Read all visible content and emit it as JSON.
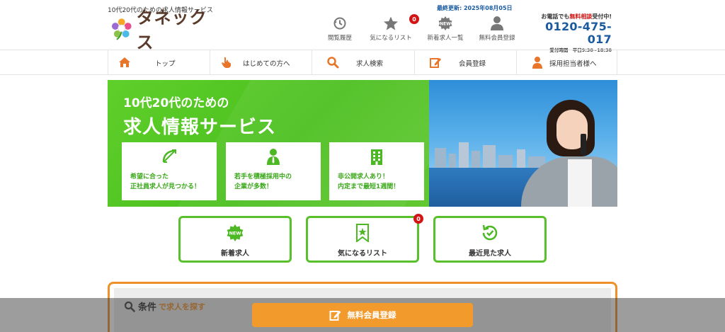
{
  "header": {
    "tagline": "10代20代のための求人情報サービス",
    "logo_text": "タネックス",
    "updated": "最終更新: 2025年08月05日",
    "nav": [
      {
        "label": "閲覧履歴",
        "icon": "history-icon"
      },
      {
        "label": "気になるリスト",
        "icon": "star-icon",
        "badge": "0"
      },
      {
        "label": "新着求人一覧",
        "icon": "new-badge-icon"
      },
      {
        "label": "無料会員登録",
        "icon": "user-icon"
      }
    ],
    "phone": {
      "line1_prefix": "お電話でも",
      "line1_highlight": "無料相談",
      "line1_suffix": "受付中!",
      "number": "0120-475-017",
      "hours": "受付時間　平日9:30~18:30"
    }
  },
  "mainnav": [
    {
      "label": "トップ",
      "icon": "home-icon"
    },
    {
      "label": "はじめての方へ",
      "icon": "hand-pointer-icon"
    },
    {
      "label": "求人検索",
      "icon": "search-icon"
    },
    {
      "label": "会員登録",
      "icon": "edit-icon"
    },
    {
      "label": "採用担当者様へ",
      "icon": "person-icon"
    }
  ],
  "hero": {
    "line1": "10代20代のための",
    "line2": "求人情報サービス",
    "features": [
      {
        "l1": "希望に合った",
        "l2": "正社員求人が見つかる！",
        "icon": "bow-arrow-icon"
      },
      {
        "l1": "若手を積極採用中の",
        "l2": "企業が多数！",
        "icon": "businessman-icon"
      },
      {
        "l1": "非公開求人あり！",
        "l2": "内定まで最短1週間！",
        "icon": "building-icon"
      }
    ]
  },
  "quick": [
    {
      "label": "新着求人",
      "icon": "new-badge-icon"
    },
    {
      "label": "気になるリスト",
      "icon": "bookmark-star-icon",
      "badge": "0"
    },
    {
      "label": "最近見た求人",
      "icon": "history-check-icon"
    }
  ],
  "search": {
    "keyword": "条件",
    "suffix": "で求人を探す"
  },
  "cta": {
    "label": "無料会員登録"
  },
  "colors": {
    "green": "#58c02a",
    "orange": "#f39a2c",
    "blue": "#1a5aa0",
    "red": "#d41414"
  }
}
